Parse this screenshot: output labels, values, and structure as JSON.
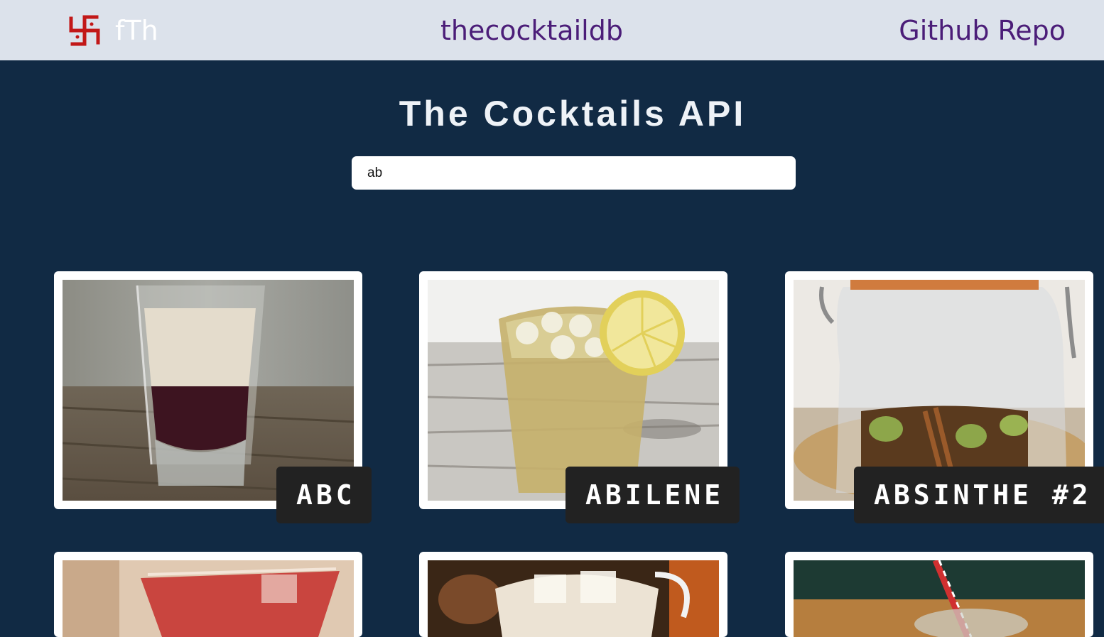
{
  "navbar": {
    "logo_text": "fTh",
    "center_link": "thecocktaildb",
    "right_link": "Github Repo"
  },
  "main": {
    "title": "The Cocktails API",
    "search_value": "ab"
  },
  "cocktails": [
    {
      "name": "ABC"
    },
    {
      "name": "ABILENE"
    },
    {
      "name": "ABSINTHE #2"
    },
    {
      "name": ""
    },
    {
      "name": ""
    },
    {
      "name": ""
    }
  ],
  "colors": {
    "navbar_bg": "#dce2eb",
    "page_bg": "#112a44",
    "link": "#4b1d78",
    "logo_icon": "#c21818",
    "label_bg": "#222222"
  },
  "icons": {
    "logo": "swastika-logo-icon"
  }
}
